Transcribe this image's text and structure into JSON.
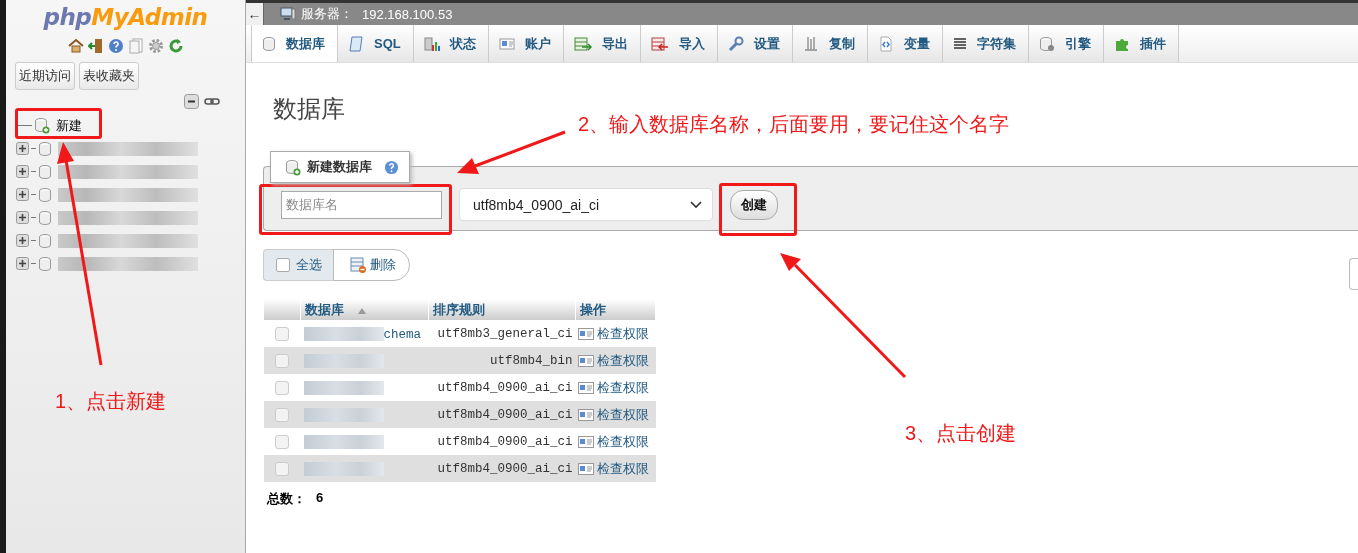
{
  "sidebar": {
    "logo": {
      "php": "php",
      "myadmin": "MyAdmin"
    },
    "buttons": [
      "近期访问",
      "表收藏夹"
    ],
    "tree": [
      {
        "kind": "new",
        "label": "新建"
      },
      {
        "kind": "database"
      },
      {
        "kind": "database"
      },
      {
        "kind": "database"
      },
      {
        "kind": "database"
      },
      {
        "kind": "database"
      },
      {
        "kind": "database"
      }
    ]
  },
  "topbar": {
    "back": "←",
    "server_label": "服务器：",
    "server": "192.168.100.53"
  },
  "tabs": [
    {
      "label": "数据库",
      "selected": true
    },
    {
      "label": "SQL",
      "selected": false
    },
    {
      "label": "状态",
      "selected": false
    },
    {
      "label": "账户",
      "selected": false
    },
    {
      "label": "导出",
      "selected": false
    },
    {
      "label": "导入",
      "selected": false
    },
    {
      "label": "设置",
      "selected": false
    },
    {
      "label": "复制",
      "selected": false
    },
    {
      "label": "变量",
      "selected": false
    },
    {
      "label": "字符集",
      "selected": false
    },
    {
      "label": "引擎",
      "selected": false
    },
    {
      "label": "插件",
      "selected": false
    }
  ],
  "content": {
    "heading": "数据库",
    "create": {
      "legend": "新建数据库",
      "name_field": {
        "placeholder": "数据库名"
      },
      "collation": "utf8mb4_0900_ai_ci",
      "button": "创建"
    },
    "bulk": {
      "select_all": "全选",
      "checked": false,
      "delete": "删除"
    },
    "table": {
      "columns": [
        {
          "label": "数据库",
          "sorted": true
        },
        {
          "label": "排序规则",
          "sorted": false
        },
        {
          "label": "操作",
          "sorted": false
        }
      ],
      "rows": [
        {
          "checked": false,
          "name": "chema",
          "collation": "utf8mb3_general_ci",
          "action": "检查权限"
        },
        {
          "checked": false,
          "collation": "utf8mb4_bin",
          "action": "检查权限"
        },
        {
          "checked": false,
          "collation": "utf8mb4_0900_ai_ci",
          "action": "检查权限"
        },
        {
          "checked": false,
          "collation": "utf8mb4_0900_ai_ci",
          "action": "检查权限"
        },
        {
          "checked": false,
          "collation": "utf8mb4_0900_ai_ci",
          "action": "检查权限"
        },
        {
          "checked": false,
          "collation": "utf8mb4_0900_ai_ci",
          "action": "检查权限"
        }
      ],
      "total_label": "总数：",
      "total": "6"
    }
  },
  "annotations": {
    "steps": [
      "1、点击新建",
      "2、输入数据库名称，后面要用，要记住这个名字",
      "3、点击创建"
    ]
  }
}
